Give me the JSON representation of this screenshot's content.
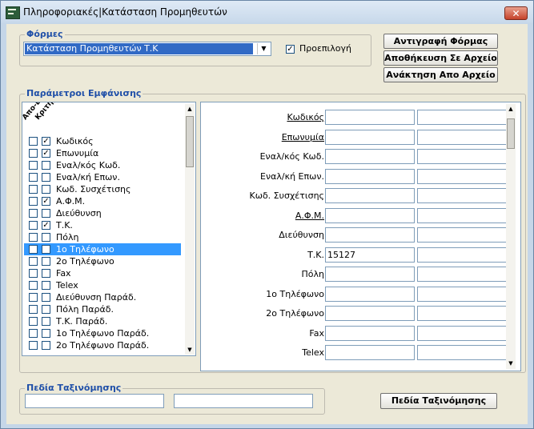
{
  "window": {
    "title": "Πληροφοριακές|Κατάσταση Προμηθευτών",
    "close_label": "✕"
  },
  "forms": {
    "legend": "Φόρμες",
    "selected": "Κατάσταση Προμηθευτών Τ.Κ",
    "default_checkbox_label": "Προεπιλογή",
    "default_checked": true,
    "buttons": [
      "Αντιγραφή Φόρμας",
      "Αποθήκευση Σε Αρχείο",
      "Ανάκτηση Απο Αρχείο"
    ]
  },
  "params": {
    "legend": "Παράμετροι Εμφάνισης",
    "col_headers": [
      "Απο-Εως",
      "Κριτήρια"
    ],
    "items": [
      {
        "label": "Κωδικός",
        "c1": false,
        "c2": true
      },
      {
        "label": "Επωνυμία",
        "c1": false,
        "c2": true
      },
      {
        "label": "Εναλ/κός Κωδ.",
        "c1": false,
        "c2": false
      },
      {
        "label": "Εναλ/κή Επων.",
        "c1": false,
        "c2": false
      },
      {
        "label": "Κωδ. Συσχέτισης",
        "c1": false,
        "c2": false
      },
      {
        "label": "Α.Φ.Μ.",
        "c1": false,
        "c2": true
      },
      {
        "label": "Διεύθυνση",
        "c1": false,
        "c2": false
      },
      {
        "label": "Τ.Κ.",
        "c1": false,
        "c2": true
      },
      {
        "label": "Πόλη",
        "c1": false,
        "c2": false
      },
      {
        "label": "1ο Τηλέφωνο",
        "c1": false,
        "c2": false,
        "selected": true
      },
      {
        "label": "2ο Τηλέφωνο",
        "c1": false,
        "c2": false
      },
      {
        "label": "Fax",
        "c1": false,
        "c2": false
      },
      {
        "label": "Telex",
        "c1": false,
        "c2": false
      },
      {
        "label": "Διεύθυνση Παράδ.",
        "c1": false,
        "c2": false
      },
      {
        "label": "Πόλη Παράδ.",
        "c1": false,
        "c2": false
      },
      {
        "label": "Τ.Κ. Παράδ.",
        "c1": false,
        "c2": false
      },
      {
        "label": "1ο Τηλέφωνο Παράδ.",
        "c1": false,
        "c2": false
      },
      {
        "label": "2ο Τηλέφωνο Παράδ.",
        "c1": false,
        "c2": false
      }
    ]
  },
  "criteria": {
    "fields": [
      {
        "label": "Κωδικός",
        "underline": true,
        "from": "",
        "to": ""
      },
      {
        "label": "Επωνυμία",
        "underline": true,
        "from": "",
        "to": ""
      },
      {
        "label": "Εναλ/κός Κωδ.",
        "underline": false,
        "from": "",
        "to": ""
      },
      {
        "label": "Εναλ/κή Επων.",
        "underline": false,
        "from": "",
        "to": ""
      },
      {
        "label": "Κωδ. Συσχέτισης",
        "underline": false,
        "from": "",
        "to": ""
      },
      {
        "label": "Α.Φ.Μ.",
        "underline": true,
        "from": "",
        "to": ""
      },
      {
        "label": "Διεύθυνση",
        "underline": false,
        "from": "",
        "to": ""
      },
      {
        "label": "Τ.Κ.",
        "underline": false,
        "from": "15127",
        "to": ""
      },
      {
        "label": "Πόλη",
        "underline": false,
        "from": "",
        "to": ""
      },
      {
        "label": "1ο Τηλέφωνο",
        "underline": false,
        "from": "",
        "to": ""
      },
      {
        "label": "2ο Τηλέφωνο",
        "underline": false,
        "from": "",
        "to": ""
      },
      {
        "label": "Fax",
        "underline": false,
        "from": "",
        "to": ""
      },
      {
        "label": "Telex",
        "underline": false,
        "from": "",
        "to": ""
      }
    ]
  },
  "sorting": {
    "legend": "Πεδία Ταξινόμησης",
    "inputs": [
      "",
      ""
    ],
    "button": "Πεδία Ταξινόμησης"
  },
  "colors": {
    "accent": "#1f4fa8",
    "selection": "#3399ff",
    "combo_selection": "#316ac5"
  }
}
